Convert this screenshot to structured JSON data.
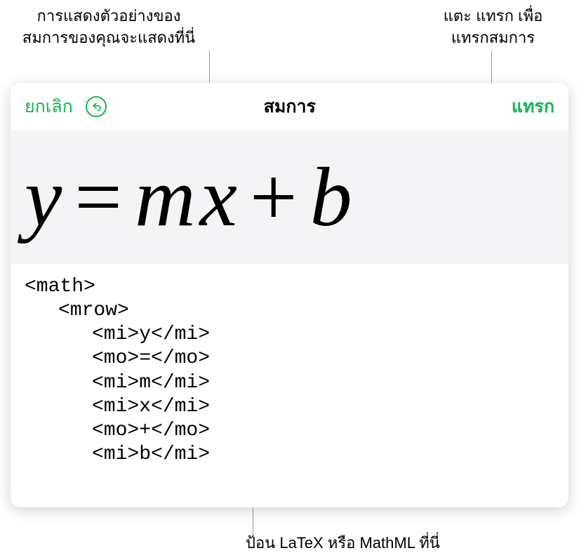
{
  "callouts": {
    "preview": "การแสดงตัวอย่างของ\nสมการของคุณจะแสดงที่นี่",
    "insert": "แตะ แทรก เพื่อ\nแทรกสมการ",
    "editor": "ป้อน LaTeX หรือ MathML ที่นี่"
  },
  "toolbar": {
    "cancel_label": "ยกเลิก",
    "title": "สมการ",
    "insert_label": "แทรก"
  },
  "equation": {
    "y": "y",
    "eq": "=",
    "m": "m",
    "x": "x",
    "plus": "+",
    "b": "b"
  },
  "editor": {
    "line1": "<math>",
    "line2": "<mrow>",
    "line3": "<mi>y</mi>",
    "line4": "<mo>=</mo>",
    "line5": "<mi>m</mi>",
    "line6": "<mi>x</mi>",
    "line7": "<mo>+</mo>",
    "line8": "<mi>b</mi>"
  }
}
